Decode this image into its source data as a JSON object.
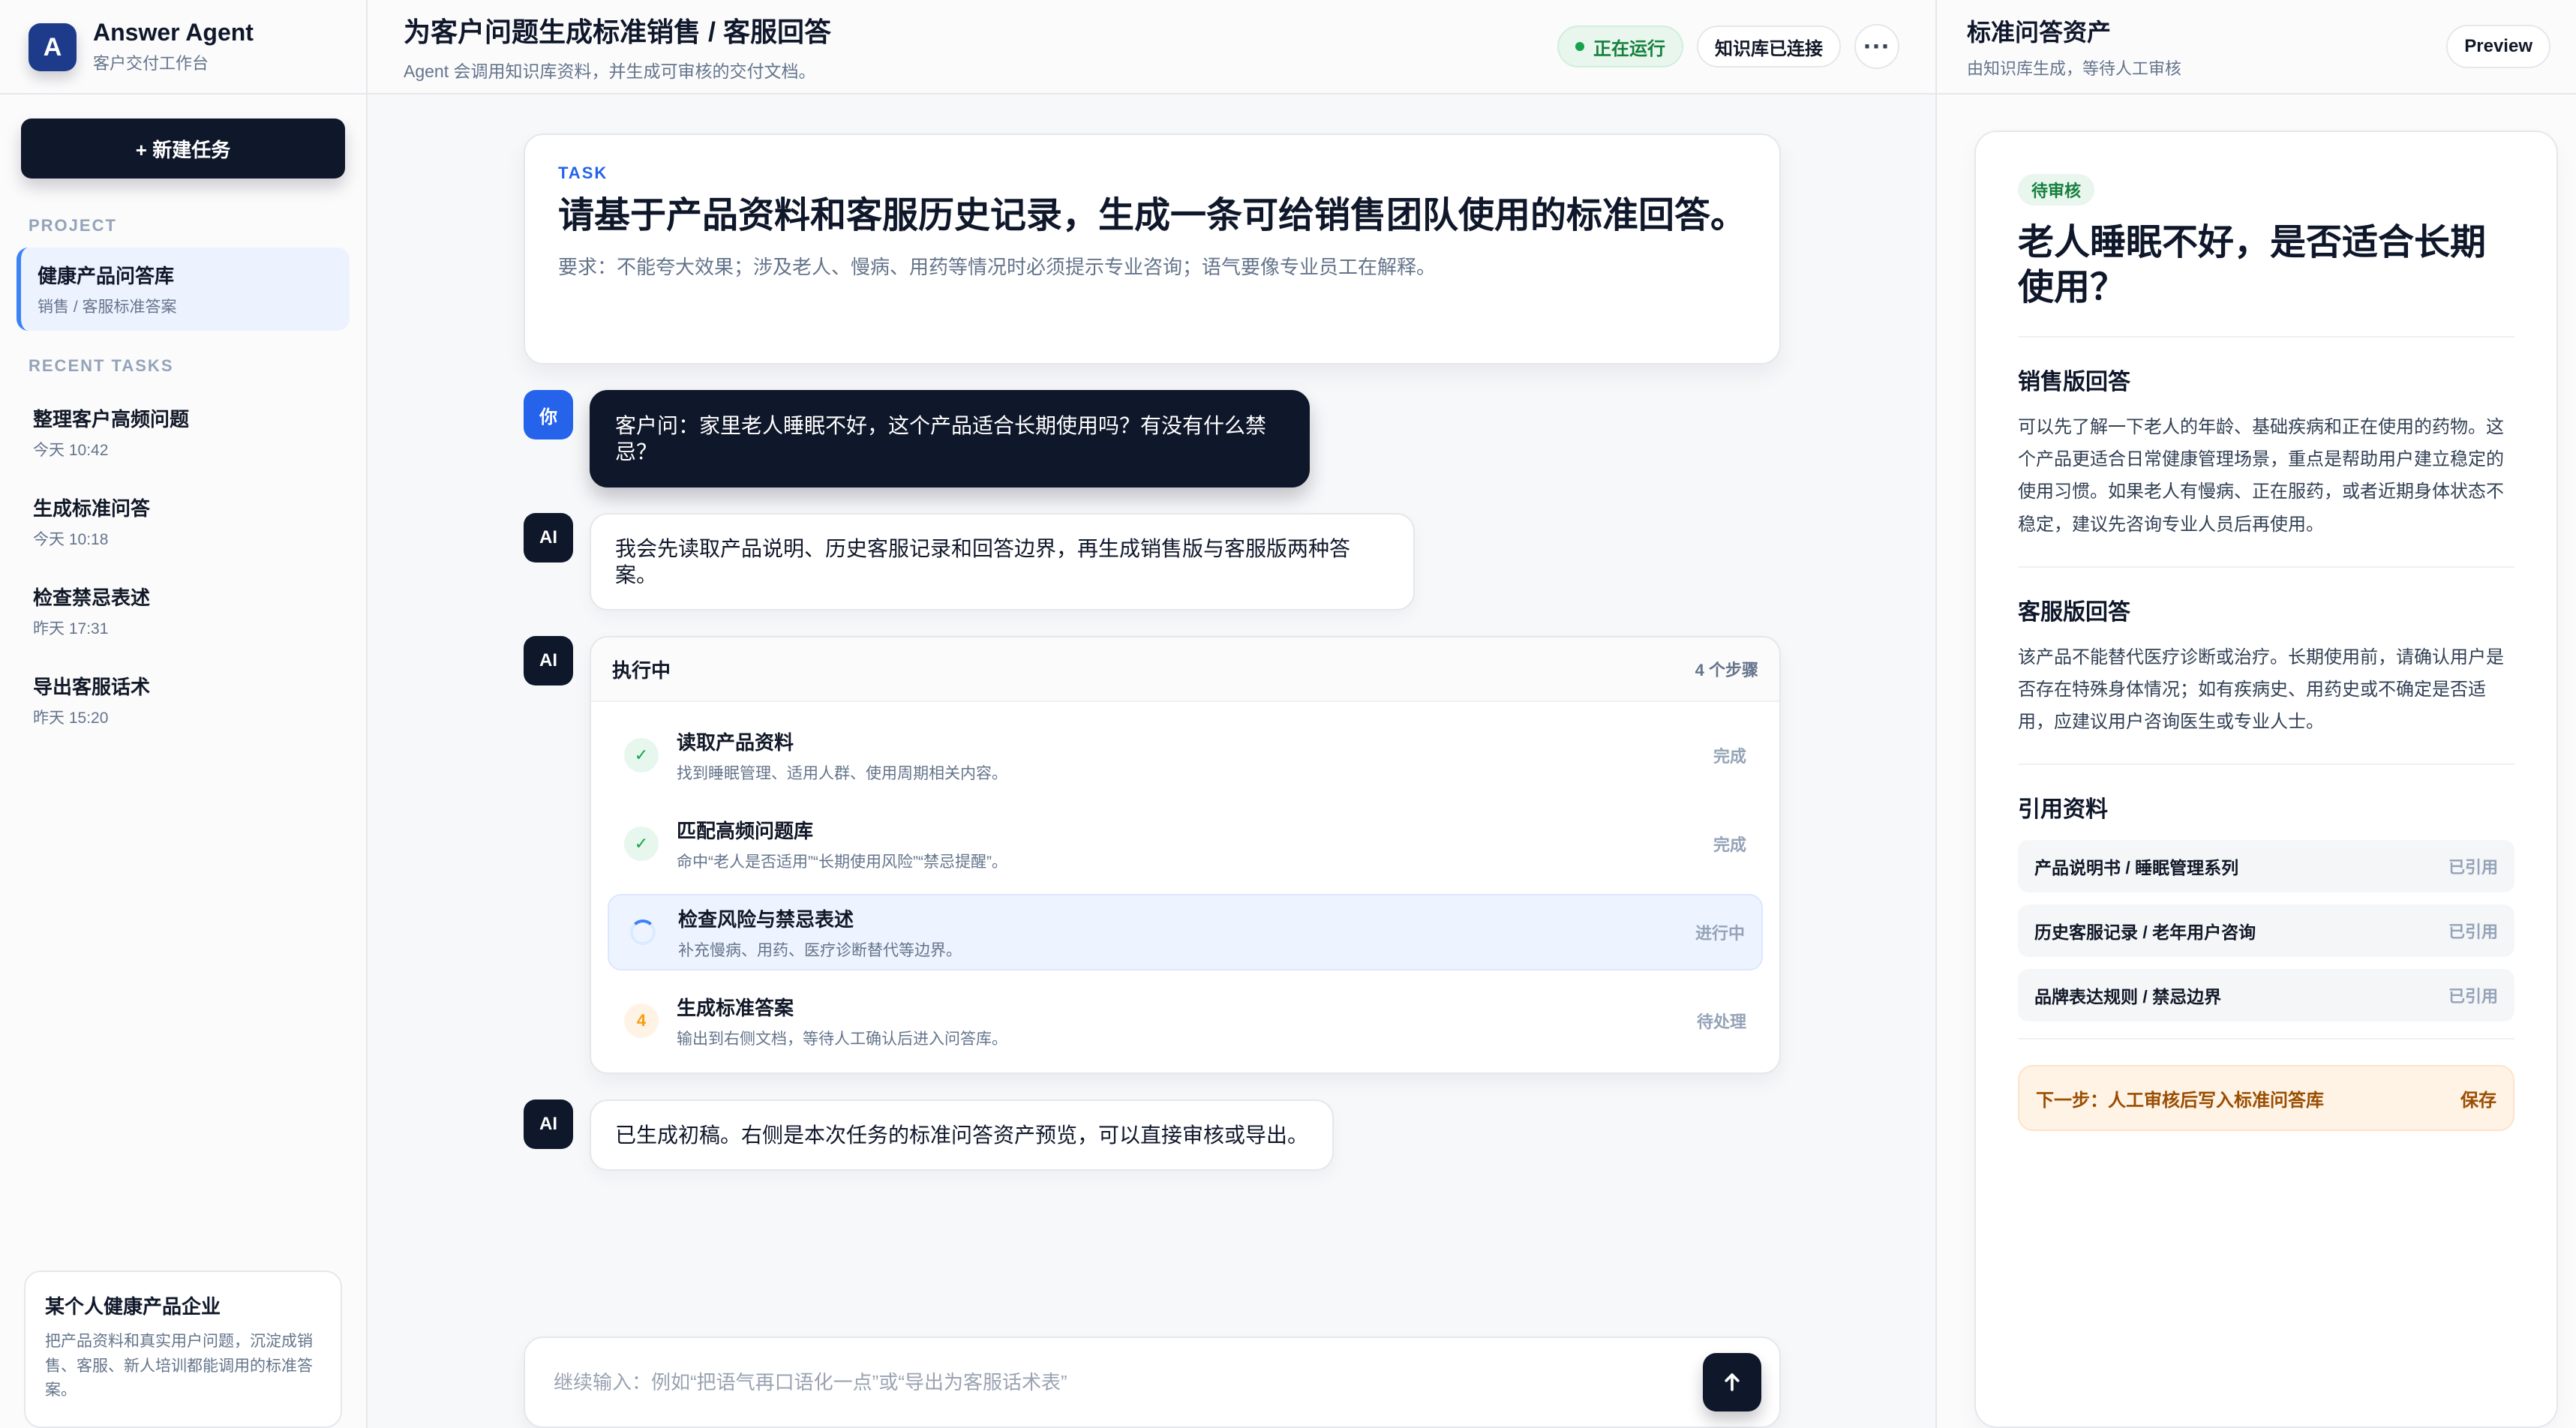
{
  "sidebar": {
    "brand": {
      "logo_letter": "A",
      "name": "Answer Agent",
      "subtitle": "客户交付工作台"
    },
    "new_task_label": "+ 新建任务",
    "project_section_title": "PROJECT",
    "project": {
      "title": "健康产品问答库",
      "subtitle": "销售 / 客服标准答案"
    },
    "recent_section_title": "RECENT TASKS",
    "recent_tasks": [
      {
        "title": "整理客户高频问题",
        "time": "今天 10:42"
      },
      {
        "title": "生成标准问答",
        "time": "今天 10:18"
      },
      {
        "title": "检查禁忌表述",
        "time": "昨天 17:31"
      },
      {
        "title": "导出客服话术",
        "time": "昨天 15:20"
      }
    ],
    "company_card": {
      "title": "某个人健康产品企业",
      "desc": "把产品资料和真实用户问题，沉淀成销售、客服、新人培训都能调用的标准答案。"
    }
  },
  "main": {
    "header": {
      "title": "为客户问题生成标准销售 / 客服回答",
      "subtitle": "Agent 会调用知识库资料，并生成可审核的交付文档。",
      "status_running": "正在运行",
      "kb_connected": "知识库已连接",
      "more_label": "···"
    },
    "task_card": {
      "label": "TASK",
      "title": "请基于产品资料和客服历史记录，生成一条可给销售团队使用的标准回答。",
      "requirements": "要求：不能夸大效果；涉及老人、慢病、用药等情况时必须提示专业咨询；语气要像专业员工在解释。"
    },
    "messages": {
      "you_avatar": "你",
      "you_text": "客户问：家里老人睡眠不好，这个产品适合长期使用吗？有没有什么禁忌？",
      "ai_avatar_1": "AI",
      "ai_text_1": "我会先读取产品说明、历史客服记录和回答边界，再生成销售版与客服版两种答案。",
      "ai_avatar_2": "AI",
      "steps": {
        "title": "执行中",
        "count": "4 个步骤",
        "items": [
          {
            "title": "读取产品资料",
            "sub": "找到睡眠管理、适用人群、使用周期相关内容。",
            "status": "完成",
            "icon": "check-icon",
            "state": "done"
          },
          {
            "title": "匹配高频问题库",
            "sub": "命中“老人是否适用”“长期使用风险”“禁忌提醒”。",
            "status": "完成",
            "icon": "check-icon",
            "state": "done"
          },
          {
            "title": "检查风险与禁忌表述",
            "sub": "补充慢病、用药、医疗诊断替代等边界。",
            "status": "进行中",
            "icon": "spinner-icon",
            "state": "active"
          },
          {
            "title": "生成标准答案",
            "sub": "输出到右侧文档，等待人工确认后进入问答库。",
            "status": "待处理",
            "icon": "step-number-icon",
            "number": "4",
            "state": "todo"
          }
        ]
      },
      "ai_avatar_3": "AI",
      "ai_text_3": "已生成初稿。右侧是本次任务的标准问答资产预览，可以直接审核或导出。"
    },
    "composer": {
      "placeholder": "继续输入：例如“把语气再口语化一点”或“导出为客服话术表”"
    }
  },
  "right_panel": {
    "title": "标准问答资产",
    "subtitle": "由知识库生成，等待人工审核",
    "preview_label": "Preview",
    "card": {
      "badge": "待审核",
      "question": "老人睡眠不好，是否适合长期使用？",
      "sales_title": "销售版回答",
      "sales_text": "可以先了解一下老人的年龄、基础疾病和正在使用的药物。这个产品更适合日常健康管理场景，重点是帮助用户建立稳定的使用习惯。如果老人有慢病、正在服药，或者近期身体状态不稳定，建议先咨询专业人员后再使用。",
      "cs_title": "客服版回答",
      "cs_text": "该产品不能替代医疗诊断或治疗。长期使用前，请确认用户是否存在特殊身体情况；如有疾病史、用药史或不确定是否适用，应建议用户咨询医生或专业人士。",
      "refs_title": "引用资料",
      "refs": [
        {
          "name": "产品说明书 / 睡眠管理系列",
          "state": "已引用"
        },
        {
          "name": "历史客服记录 / 老年用户咨询",
          "state": "已引用"
        },
        {
          "name": "品牌表达规则 / 禁忌边界",
          "state": "已引用"
        }
      ],
      "next_step": "下一步：人工审核后写入标准问答库",
      "save_label": "保存"
    }
  },
  "colors": {
    "navy": "#0f172a",
    "blue": "#2563eb",
    "green": "#15803d",
    "orange": "#9a4d00"
  }
}
